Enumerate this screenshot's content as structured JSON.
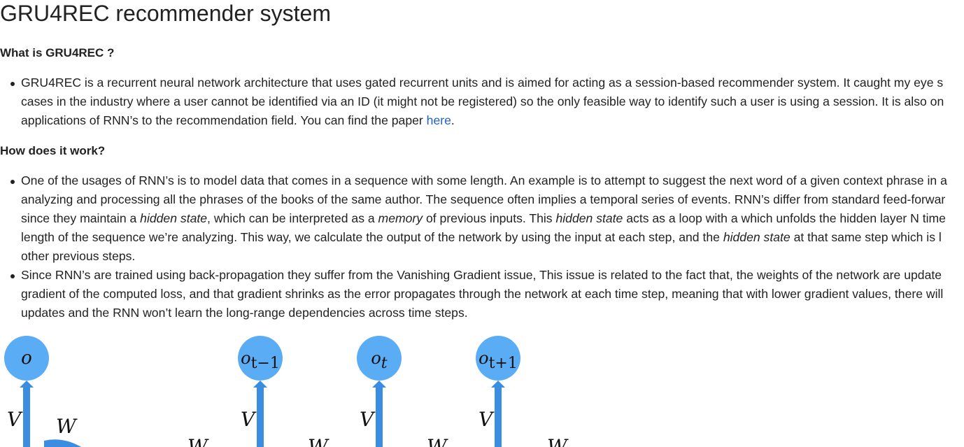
{
  "header": {
    "title": "GRU4REC recommender system"
  },
  "sections": [
    {
      "heading": "What is GRU4REC ?",
      "bullets": [
        {
          "lines": [
            "GRU4REC is a recurrent neural network architecture that uses gated recurrent units and is aimed for acting as a session-based recommender system. It caught my eye s",
            "cases in the industry where a user cannot be identified via an ID (it might not be registered) so the only feasible way to identify such a user is using a session. It is also on",
            {
              "before": "applications of RNN’s to the recommendation field. You can find the paper ",
              "link": "here",
              "after": "."
            }
          ]
        }
      ]
    },
    {
      "heading": "How does it work?",
      "bullets": [
        {
          "lines": [
            "One of the usages of RNN’s is to model data that comes in a sequence with some length. An example is to attempt to suggest the next word of a given context phrase in a",
            "analyzing and processing all the phrases of the books of the same author. The sequence often implies a temporal series of events. RNN’s differ from standard feed-forwar",
            {
              "p1": "since they maintain a ",
              "e1": "hidden state",
              "p2": ", which can be interpreted as a ",
              "e2": "memory",
              "p3": " of previous inputs. This ",
              "e3": "hidden state",
              "p4": " acts as a loop with a which unfolds the hidden layer N time"
            },
            {
              "p1": "length of the sequence we’re analyzing. This way, we calculate the output of the network by using the input at each step, and the ",
              "e1": "hidden state",
              "p2": " at that same step which is l"
            },
            "other previous steps."
          ]
        },
        {
          "lines": [
            "Since RNN’s are trained using back-propagation they suffer from the Vanishing Gradient issue, This issue is related to the fact that, the weights of the network are update",
            "gradient of the computed loss, and that gradient shrinks as the error propagates through the network at each time step, meaning that with lower gradient values, there will",
            "updates and the RNN won’t learn the long-range dependencies across time steps."
          ]
        }
      ]
    }
  ],
  "diagram": {
    "node_color": "#5aadf5",
    "arrow_color": "#3a8de0",
    "folded": {
      "output": "o",
      "weight_up": "V",
      "weight_loop": "W"
    },
    "steps": [
      {
        "output_base": "o",
        "output_sub": "t−1",
        "weight_up": "V"
      },
      {
        "output_base": "o",
        "output_sub": "t",
        "weight_up": "V"
      },
      {
        "output_base": "o",
        "output_sub": "t+1",
        "weight_up": "V"
      }
    ],
    "recurrent_weight": "W"
  }
}
